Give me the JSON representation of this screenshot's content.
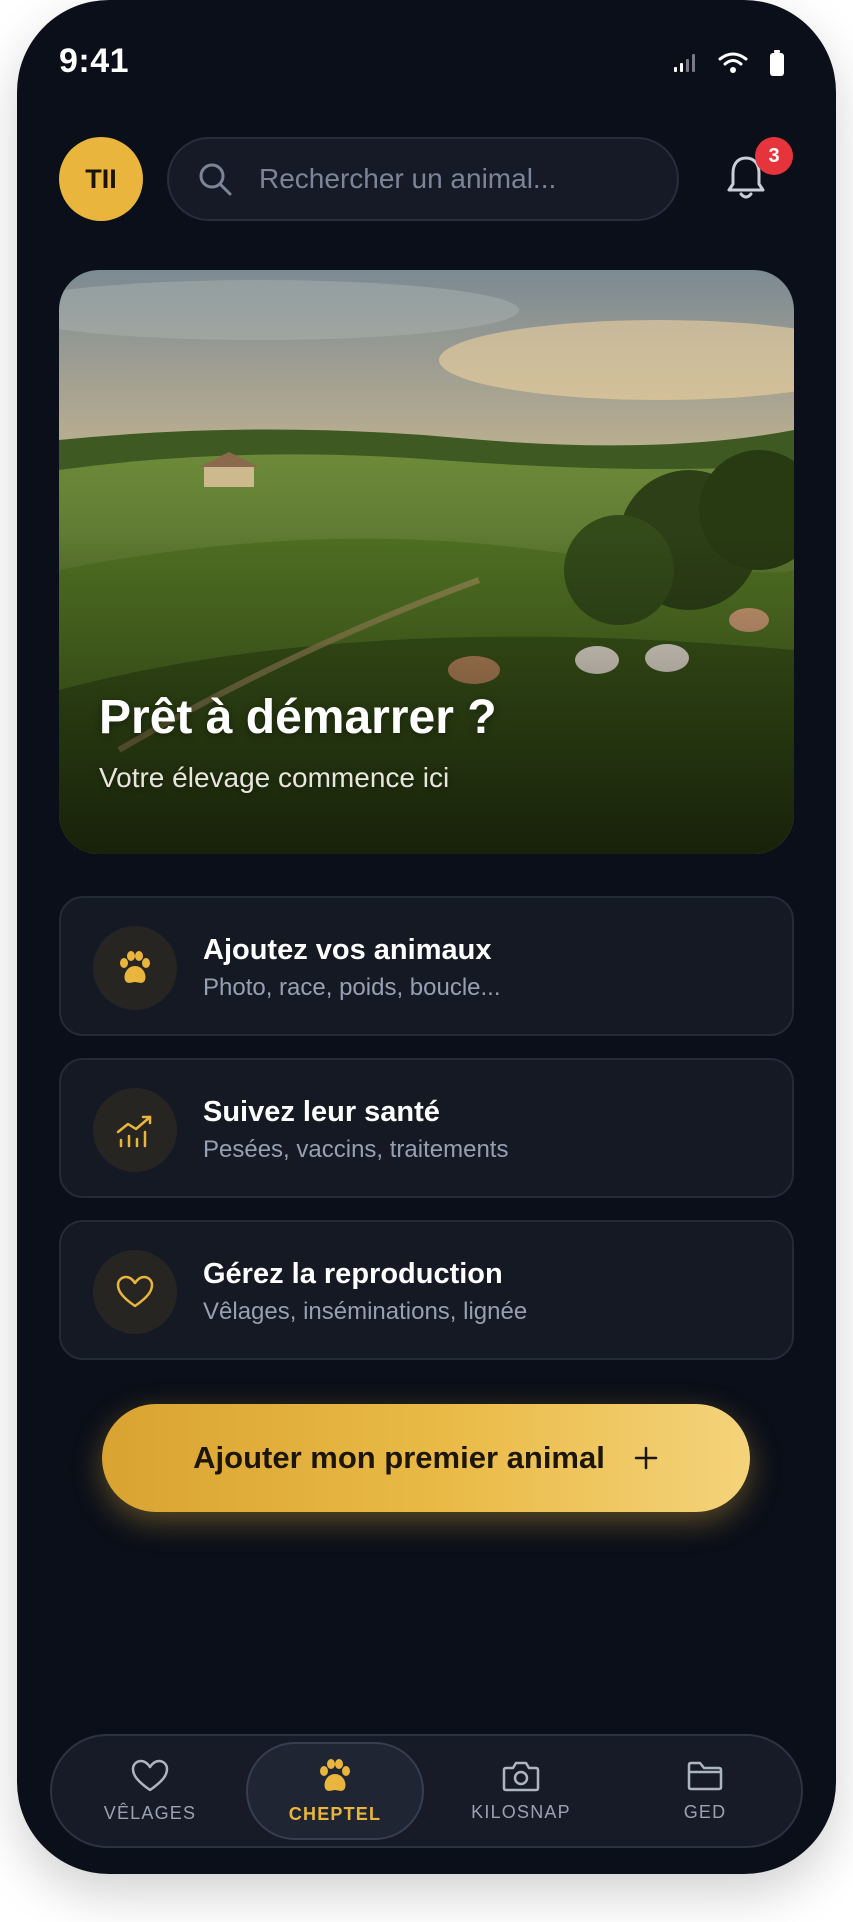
{
  "status_bar": {
    "time": "9:41"
  },
  "header": {
    "avatar_initials": "TII",
    "search_placeholder": "Rechercher un animal...",
    "notification_count": "3"
  },
  "hero": {
    "title": "Prêt à démarrer ?",
    "subtitle": "Votre élevage commence ici"
  },
  "features": [
    {
      "icon": "paw-icon",
      "title": "Ajoutez vos animaux",
      "subtitle": "Photo, race, poids, boucle..."
    },
    {
      "icon": "chart-icon",
      "title": "Suivez leur santé",
      "subtitle": "Pesées, vaccins, traitements"
    },
    {
      "icon": "heart-icon",
      "title": "Gérez la reproduction",
      "subtitle": "Vêlages, inséminations, lignée"
    }
  ],
  "cta": {
    "label": "Ajouter mon premier animal",
    "icon": "plus-icon"
  },
  "bottom_nav": {
    "items": [
      {
        "label": "VÊLAGES",
        "icon": "heart-icon"
      },
      {
        "label": "CHEPTEL",
        "icon": "paw-icon",
        "active": true
      },
      {
        "label": "KILOSNAP",
        "icon": "camera-icon"
      },
      {
        "label": "GED",
        "icon": "folder-icon"
      }
    ]
  },
  "colors": {
    "accent": "#eab53d",
    "background": "#0b0f19",
    "card": "#141924",
    "badge": "#e5343b"
  }
}
